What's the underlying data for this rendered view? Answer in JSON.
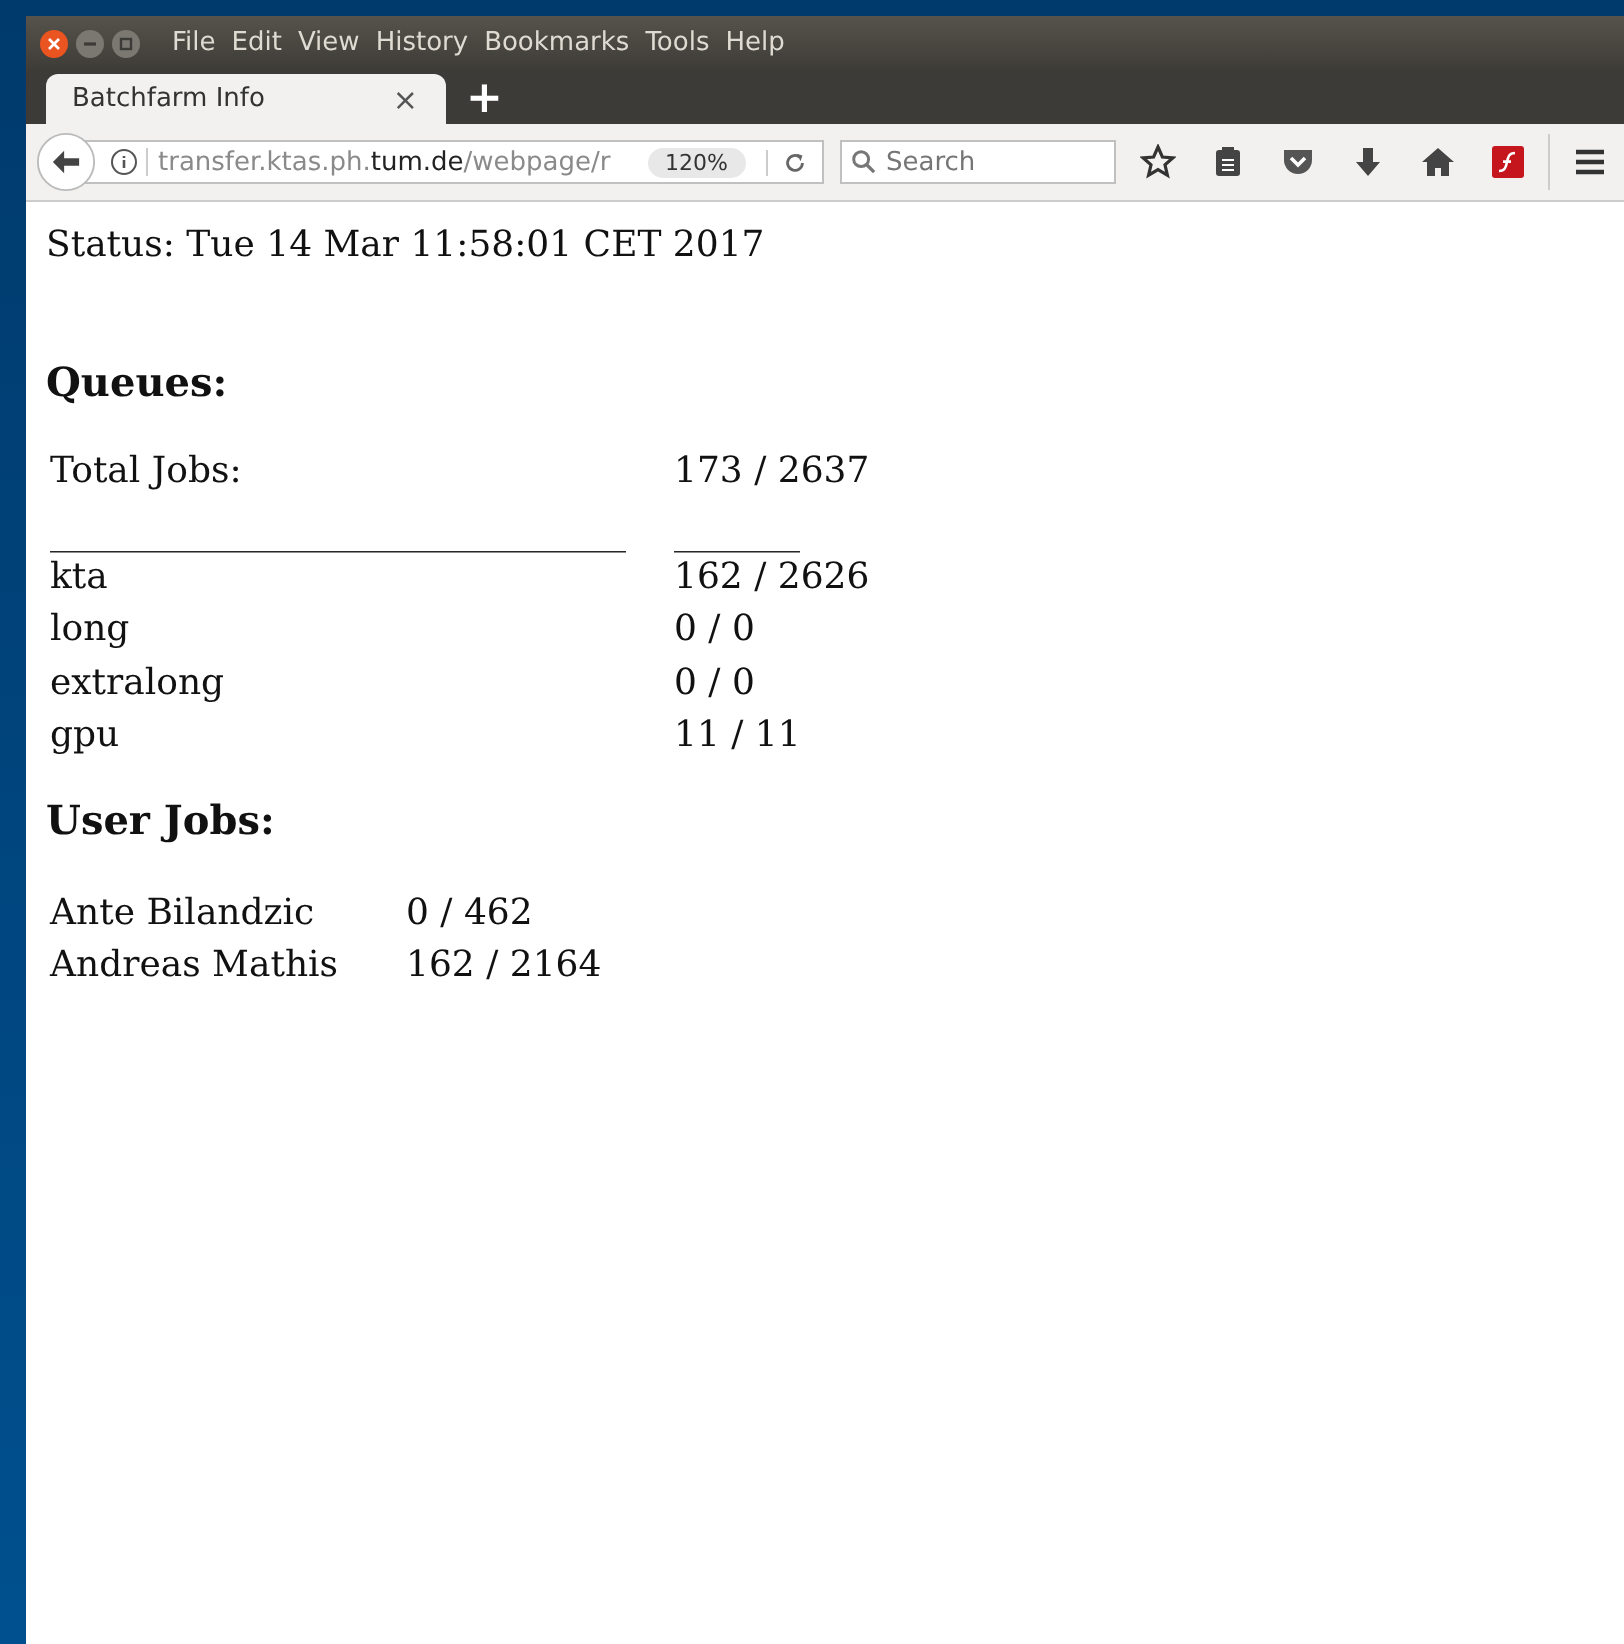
{
  "window": {
    "menu": [
      "File",
      "Edit",
      "View",
      "History",
      "Bookmarks",
      "Tools",
      "Help"
    ]
  },
  "tabs": [
    {
      "label": "Batchfarm Info",
      "selected": true,
      "close": "×"
    }
  ],
  "new_tab": "+",
  "address_bar": {
    "url_prefix": "transfer.ktas.ph.",
    "url_domain": "tum.de",
    "url_suffix": "/webpage/r",
    "zoom": "120%"
  },
  "search": {
    "placeholder": "Search"
  },
  "page": {
    "status": "Status: Tue 14 Mar 11:58:01 CET 2017",
    "queues_heading": "Queues:",
    "queues": [
      {
        "name": "Total Jobs:",
        "value": "173 / 2637"
      },
      {
        "name": "________________________________",
        "value": "_______",
        "kind": "rule"
      },
      {
        "name": "kta",
        "value": "162 / 2626"
      },
      {
        "name": "long",
        "value": "0 / 0"
      },
      {
        "name": "extralong",
        "value": "0 / 0"
      },
      {
        "name": "gpu",
        "value": "11 / 11"
      }
    ],
    "users_heading": "User Jobs:",
    "users": [
      {
        "name": "Ante Bilandzic",
        "value": "0 / 462"
      },
      {
        "name": "Andreas Mathis",
        "value": "162 / 2164"
      }
    ]
  }
}
